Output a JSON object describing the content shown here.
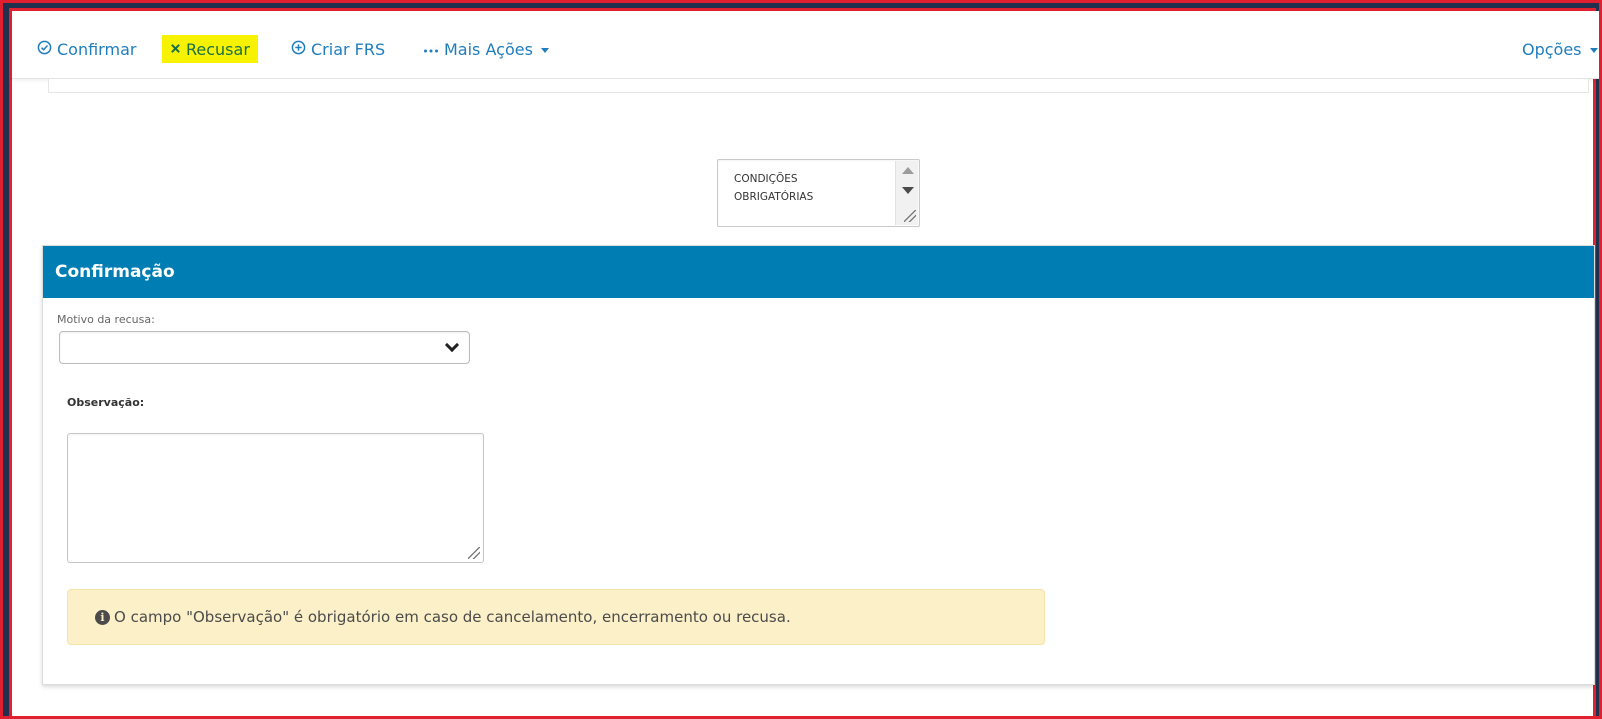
{
  "toolbar": {
    "confirm_label": "Confirmar",
    "refuse_label": "Recusar",
    "create_frs_label": "Criar FRS",
    "more_actions_label": "Mais Ações",
    "options_label": "Opções",
    "highlight_color": "#f7f300",
    "link_color": "#1f7dbd"
  },
  "conditions_box": {
    "text": "CONDIÇÕES\nOBRIGATÓRIAS"
  },
  "panel": {
    "title": "Confirmação",
    "header_color": "#007eb3",
    "motivo_label": "Motivo da recusa:",
    "motivo_value": "",
    "observacao_label": "Observação:",
    "observacao_value": "",
    "alert_text": "O campo \"Observação\" é obrigatório em caso de cancelamento, encerramento ou recusa."
  },
  "icons": {
    "confirm": "check-circle-icon",
    "refuse": "x-icon",
    "create_frs": "plus-circle-icon",
    "more_actions": "ellipsis-icon",
    "info": "info-circle-icon"
  }
}
